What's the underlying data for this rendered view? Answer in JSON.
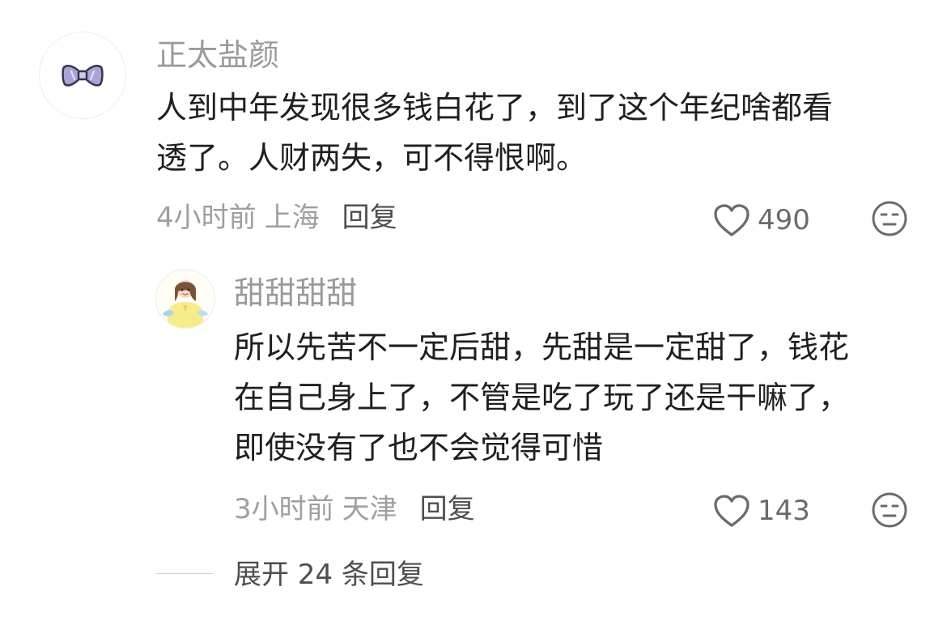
{
  "comments": [
    {
      "avatar_icon": "bow-icon",
      "username": "正太盐颜",
      "body_lines": [
        "人到中年发现很多钱白花了，到了这个年纪啥都看",
        "透了。人财两失，可不得恨啊。"
      ],
      "time": "4小时前",
      "location": "上海",
      "reply_label": "回复",
      "likes": "490",
      "like_icon": "heart-icon",
      "emoji_icon": "neutral-face-icon"
    },
    {
      "avatar_icon": "girl-avatar-icon",
      "username": "甜甜甜甜",
      "body_lines": [
        "所以先苦不一定后甜，先甜是一定甜了，钱花",
        "在自己身上了，不管是吃了玩了还是干嘛了，",
        "即使没有了也不会觉得可惜"
      ],
      "time": "3小时前",
      "location": "天津",
      "reply_label": "回复",
      "likes": "143",
      "like_icon": "heart-icon",
      "emoji_icon": "neutral-face-icon"
    }
  ],
  "expand_label": "展开 24 条回复",
  "colors": {
    "username": "#9a9a9a",
    "body": "#1f1f1f",
    "meta": "#9f9f9f",
    "action": "#4e4e4e"
  }
}
